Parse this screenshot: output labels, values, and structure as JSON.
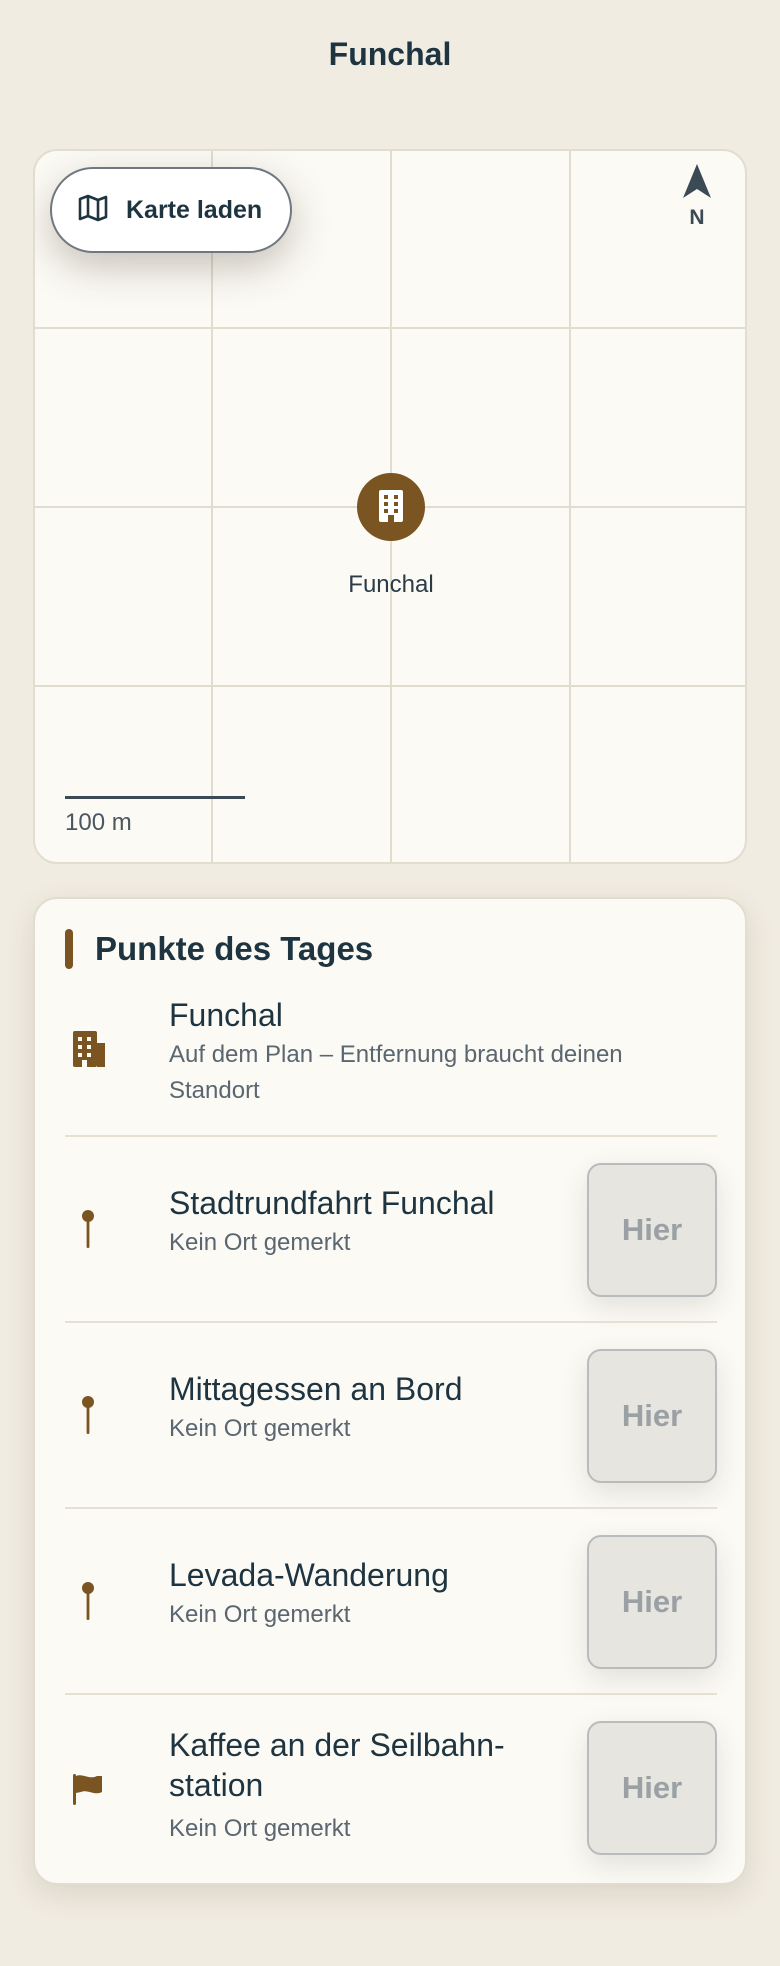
{
  "header": {
    "title": "Funchal"
  },
  "map": {
    "load_button_label": "Karte laden",
    "north_label": "N",
    "marker_label": "Funchal",
    "scale_label": "100 m"
  },
  "points": {
    "title": "Punkte des Tages",
    "items": [
      {
        "title": "Funchal",
        "subtitle": "Auf dem Plan – Entfernung braucht deinen Standort",
        "icon": "building-icon"
      },
      {
        "title": "Stadtrundfahrt Funchal",
        "subtitle": "Kein Ort gemerkt",
        "icon": "pin-icon",
        "action_label": "Hier"
      },
      {
        "title": "Mittagessen an Bord",
        "subtitle": "Kein Ort gemerkt",
        "icon": "pin-icon",
        "action_label": "Hier"
      },
      {
        "title": "Levada-Wanderung",
        "subtitle": "Kein Ort gemerkt",
        "icon": "pin-icon",
        "action_label": "Hier"
      },
      {
        "title": "Kaffee an der Seilbahn-station",
        "subtitle": "Kein Ort gemerkt",
        "icon": "flag-icon",
        "action_label": "Hier"
      }
    ]
  },
  "colors": {
    "background": "#f1ece1",
    "card": "#fcfaf5",
    "accent": "#7a5522",
    "text": "#1e3440",
    "muted": "#5a6670"
  }
}
